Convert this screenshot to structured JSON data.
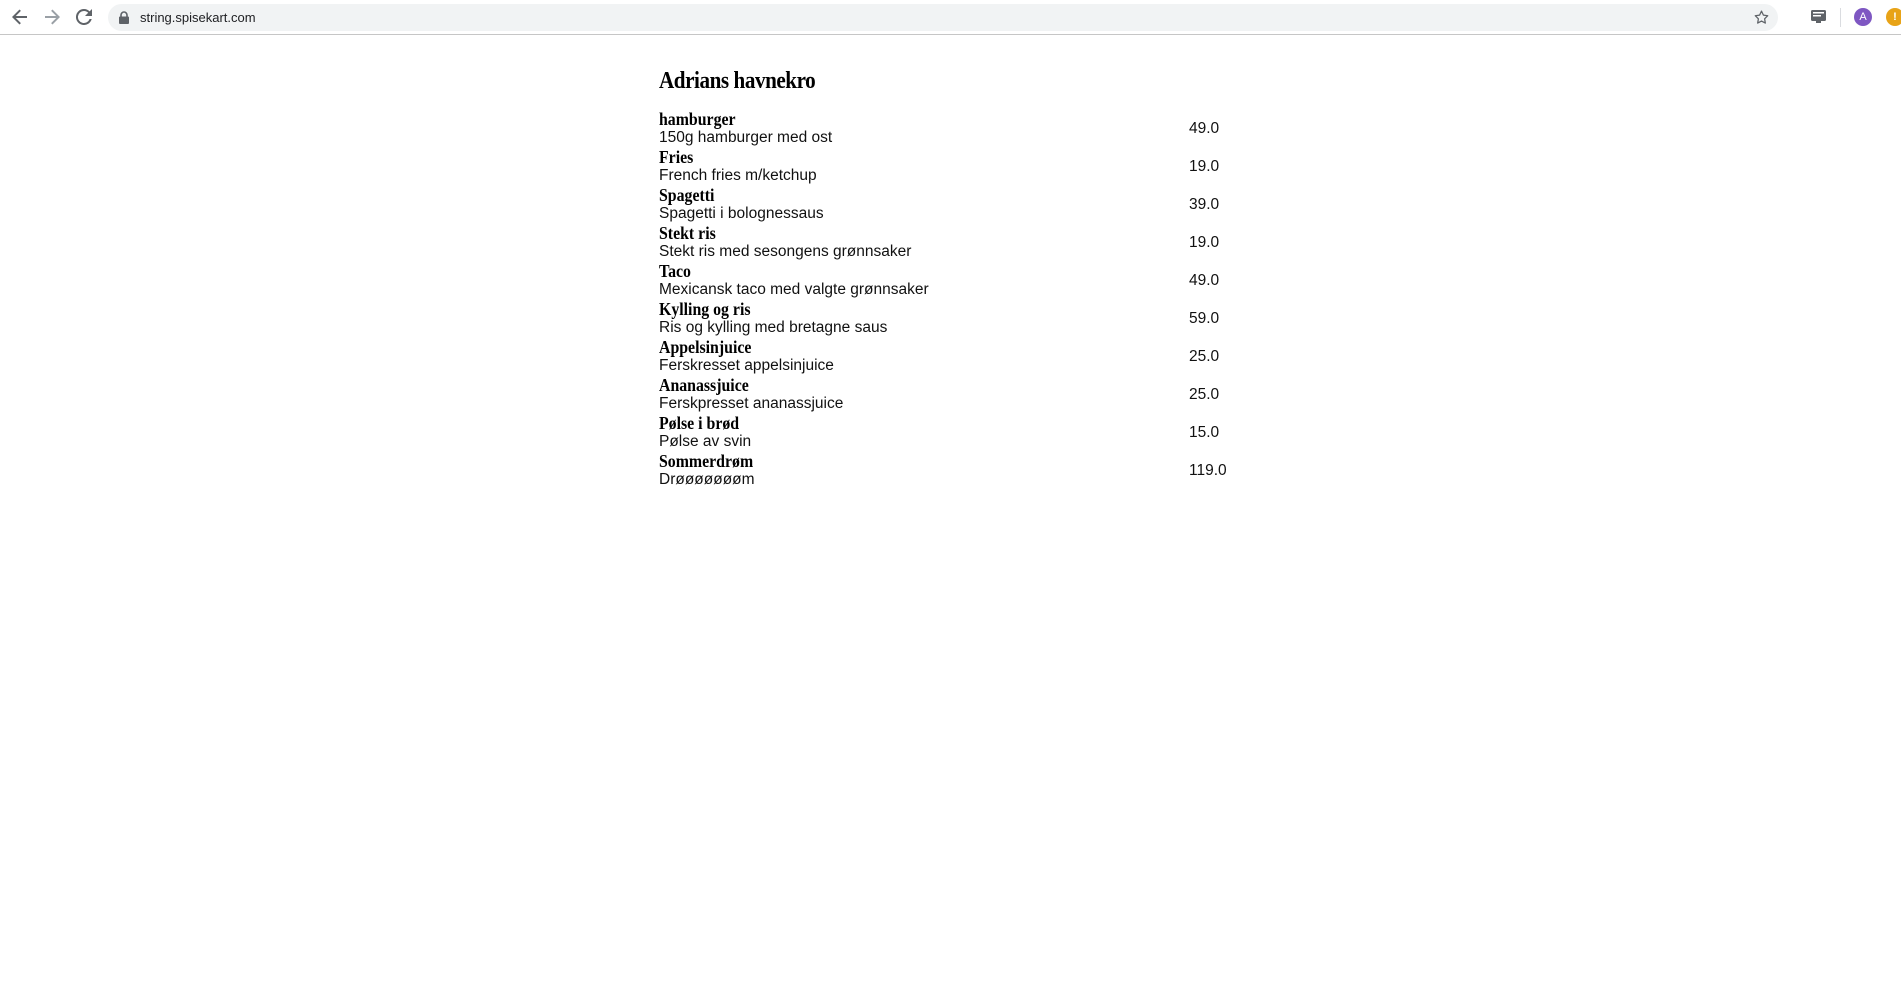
{
  "browser": {
    "url": "string.spisekart.com",
    "avatar_letter": "A",
    "update_badge": "!"
  },
  "menu": {
    "restaurant_name": "Adrians havnekro",
    "items": [
      {
        "name": "hamburger",
        "description": "150g hamburger med ost",
        "price": "49.0"
      },
      {
        "name": "Fries",
        "description": "French fries m/ketchup",
        "price": "19.0"
      },
      {
        "name": "Spagetti",
        "description": "Spagetti i bolognessaus",
        "price": "39.0"
      },
      {
        "name": "Stekt ris",
        "description": "Stekt ris med sesongens grønnsaker",
        "price": "19.0"
      },
      {
        "name": "Taco",
        "description": "Mexicansk taco med valgte grønnsaker",
        "price": "49.0"
      },
      {
        "name": "Kylling og ris",
        "description": "Ris og kylling med bretagne saus",
        "price": "59.0"
      },
      {
        "name": "Appelsinjuice",
        "description": "Ferskresset appelsinjuice",
        "price": "25.0"
      },
      {
        "name": "Ananassjuice",
        "description": "Ferskpresset ananassjuice",
        "price": "25.0"
      },
      {
        "name": "Pølse i brød",
        "description": "Pølse av svin",
        "price": "15.0"
      },
      {
        "name": "Sommerdrøm",
        "description": "Drøøøøøøøm",
        "price": "119.0"
      }
    ]
  }
}
